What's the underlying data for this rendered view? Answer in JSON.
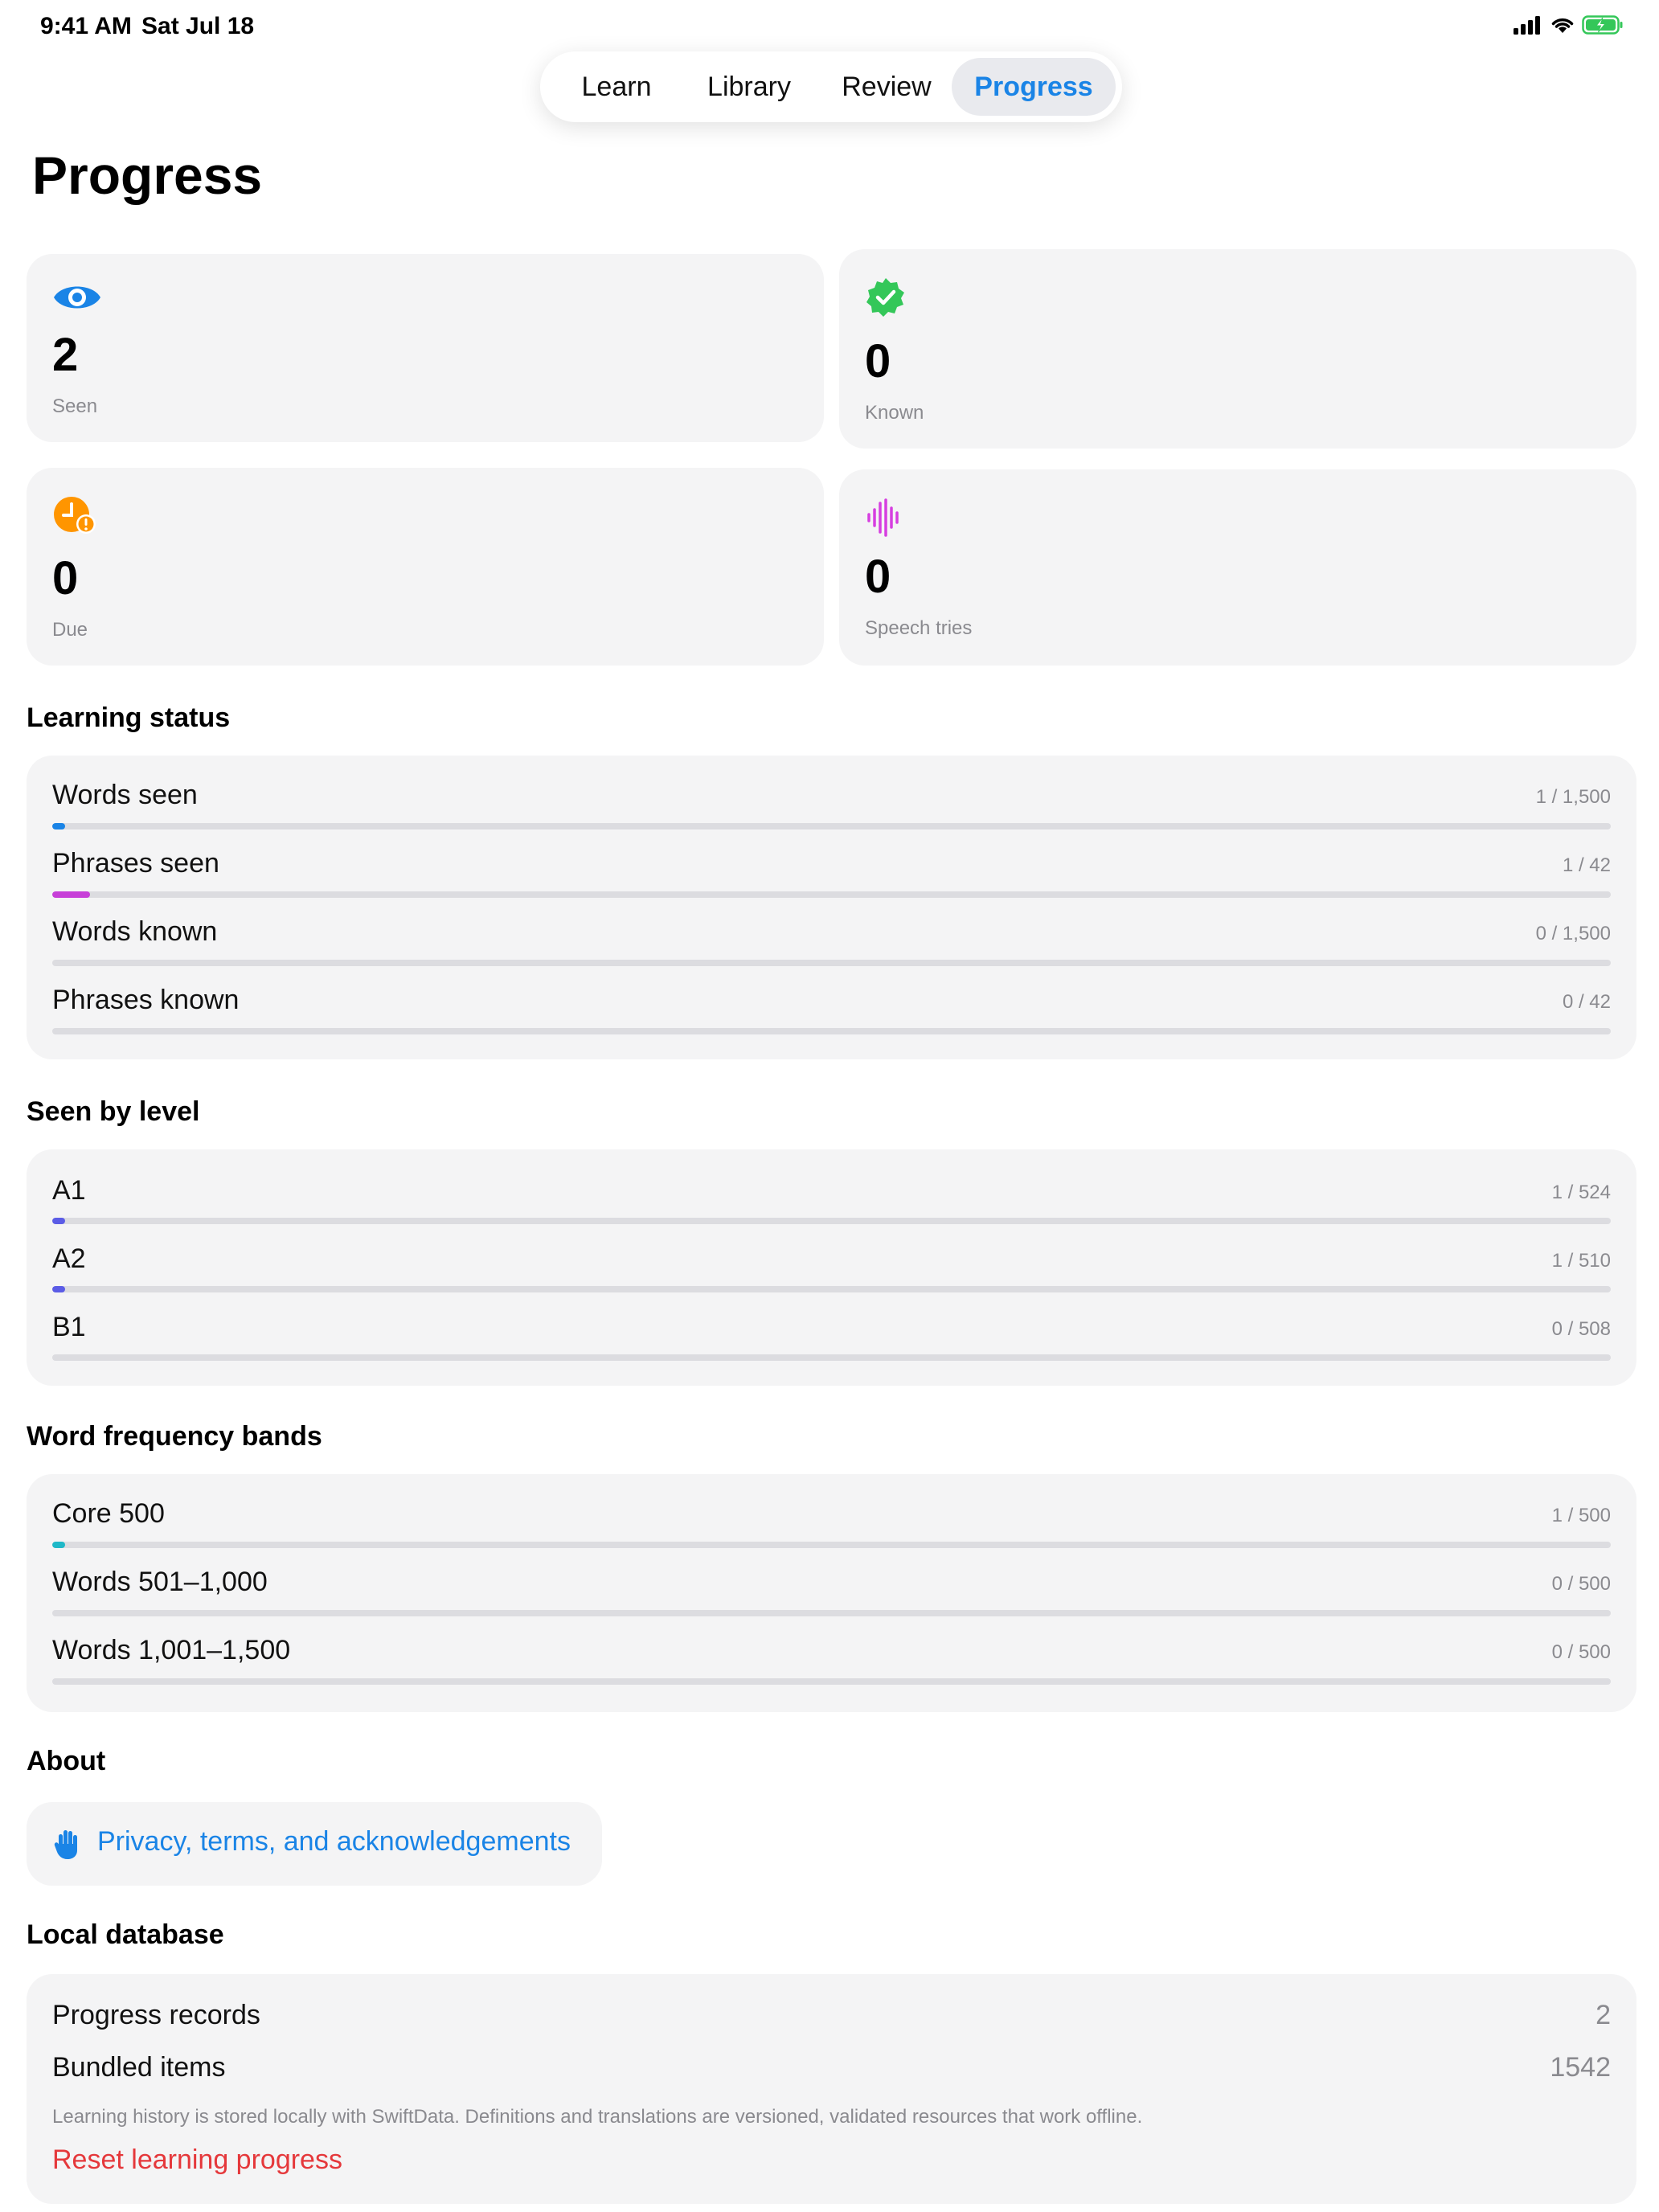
{
  "status": {
    "time": "9:41 AM",
    "date": "Sat Jul 18",
    "icons": [
      "signal-icon",
      "wifi-icon",
      "battery-charging-icon"
    ]
  },
  "tabs": [
    {
      "label": "Learn",
      "active": false
    },
    {
      "label": "Library",
      "active": false
    },
    {
      "label": "Review",
      "active": false
    },
    {
      "label": "Progress",
      "active": true
    }
  ],
  "page_title": "Progress",
  "stats": [
    {
      "icon": "eye-icon",
      "value": "2",
      "label": "Seen",
      "color": "#1a84e6"
    },
    {
      "icon": "checkmark-seal-icon",
      "value": "0",
      "label": "Known",
      "color": "#34c759"
    },
    {
      "icon": "clock-badge-exclamation-icon",
      "value": "0",
      "label": "Due",
      "color": "#ff9500"
    },
    {
      "icon": "waveform-icon",
      "value": "0",
      "label": "Speech tries",
      "color": "#d63ee0"
    }
  ],
  "learning_status": {
    "title": "Learning status",
    "rows": [
      {
        "label": "Words seen",
        "count": "1 / 1,500",
        "progress": 0.0007,
        "color": "#1a84e6"
      },
      {
        "label": "Phrases seen",
        "count": "1 / 42",
        "progress": 0.024,
        "color": "#c740d8"
      },
      {
        "label": "Words known",
        "count": "0 / 1,500",
        "progress": 0,
        "color": "#34c759"
      },
      {
        "label": "Phrases known",
        "count": "0 / 42",
        "progress": 0,
        "color": "#34c759"
      }
    ]
  },
  "seen_by_level": {
    "title": "Seen by level",
    "rows": [
      {
        "label": "A1",
        "count": "1 / 524",
        "progress": 0.0019,
        "color": "#5b5ce6"
      },
      {
        "label": "A2",
        "count": "1 / 510",
        "progress": 0.002,
        "color": "#5b5ce6"
      },
      {
        "label": "B1",
        "count": "0 / 508",
        "progress": 0,
        "color": "#5b5ce6"
      }
    ]
  },
  "frequency_bands": {
    "title": "Word frequency bands",
    "rows": [
      {
        "label": "Core 500",
        "count": "1 / 500",
        "progress": 0.002,
        "color": "#1fb8c8"
      },
      {
        "label": "Words 501–1,000",
        "count": "0 / 500",
        "progress": 0,
        "color": "#1fb8c8"
      },
      {
        "label": "Words 1,001–1,500",
        "count": "0 / 500",
        "progress": 0,
        "color": "#1fb8c8"
      }
    ]
  },
  "about": {
    "title": "About",
    "link_icon": "hand-raised-icon",
    "link_label": "Privacy, terms, and acknowledgements"
  },
  "local_db": {
    "title": "Local database",
    "progress_records_label": "Progress records",
    "progress_records_value": "2",
    "bundled_items_label": "Bundled items",
    "bundled_items_value": "1542",
    "note": "Learning history is stored locally with SwiftData. Definitions and translations are versioned, validated resources that work offline.",
    "reset_label": "Reset learning progress"
  },
  "accent_color": "#1a84e6",
  "destructive_color": "#e5383b"
}
